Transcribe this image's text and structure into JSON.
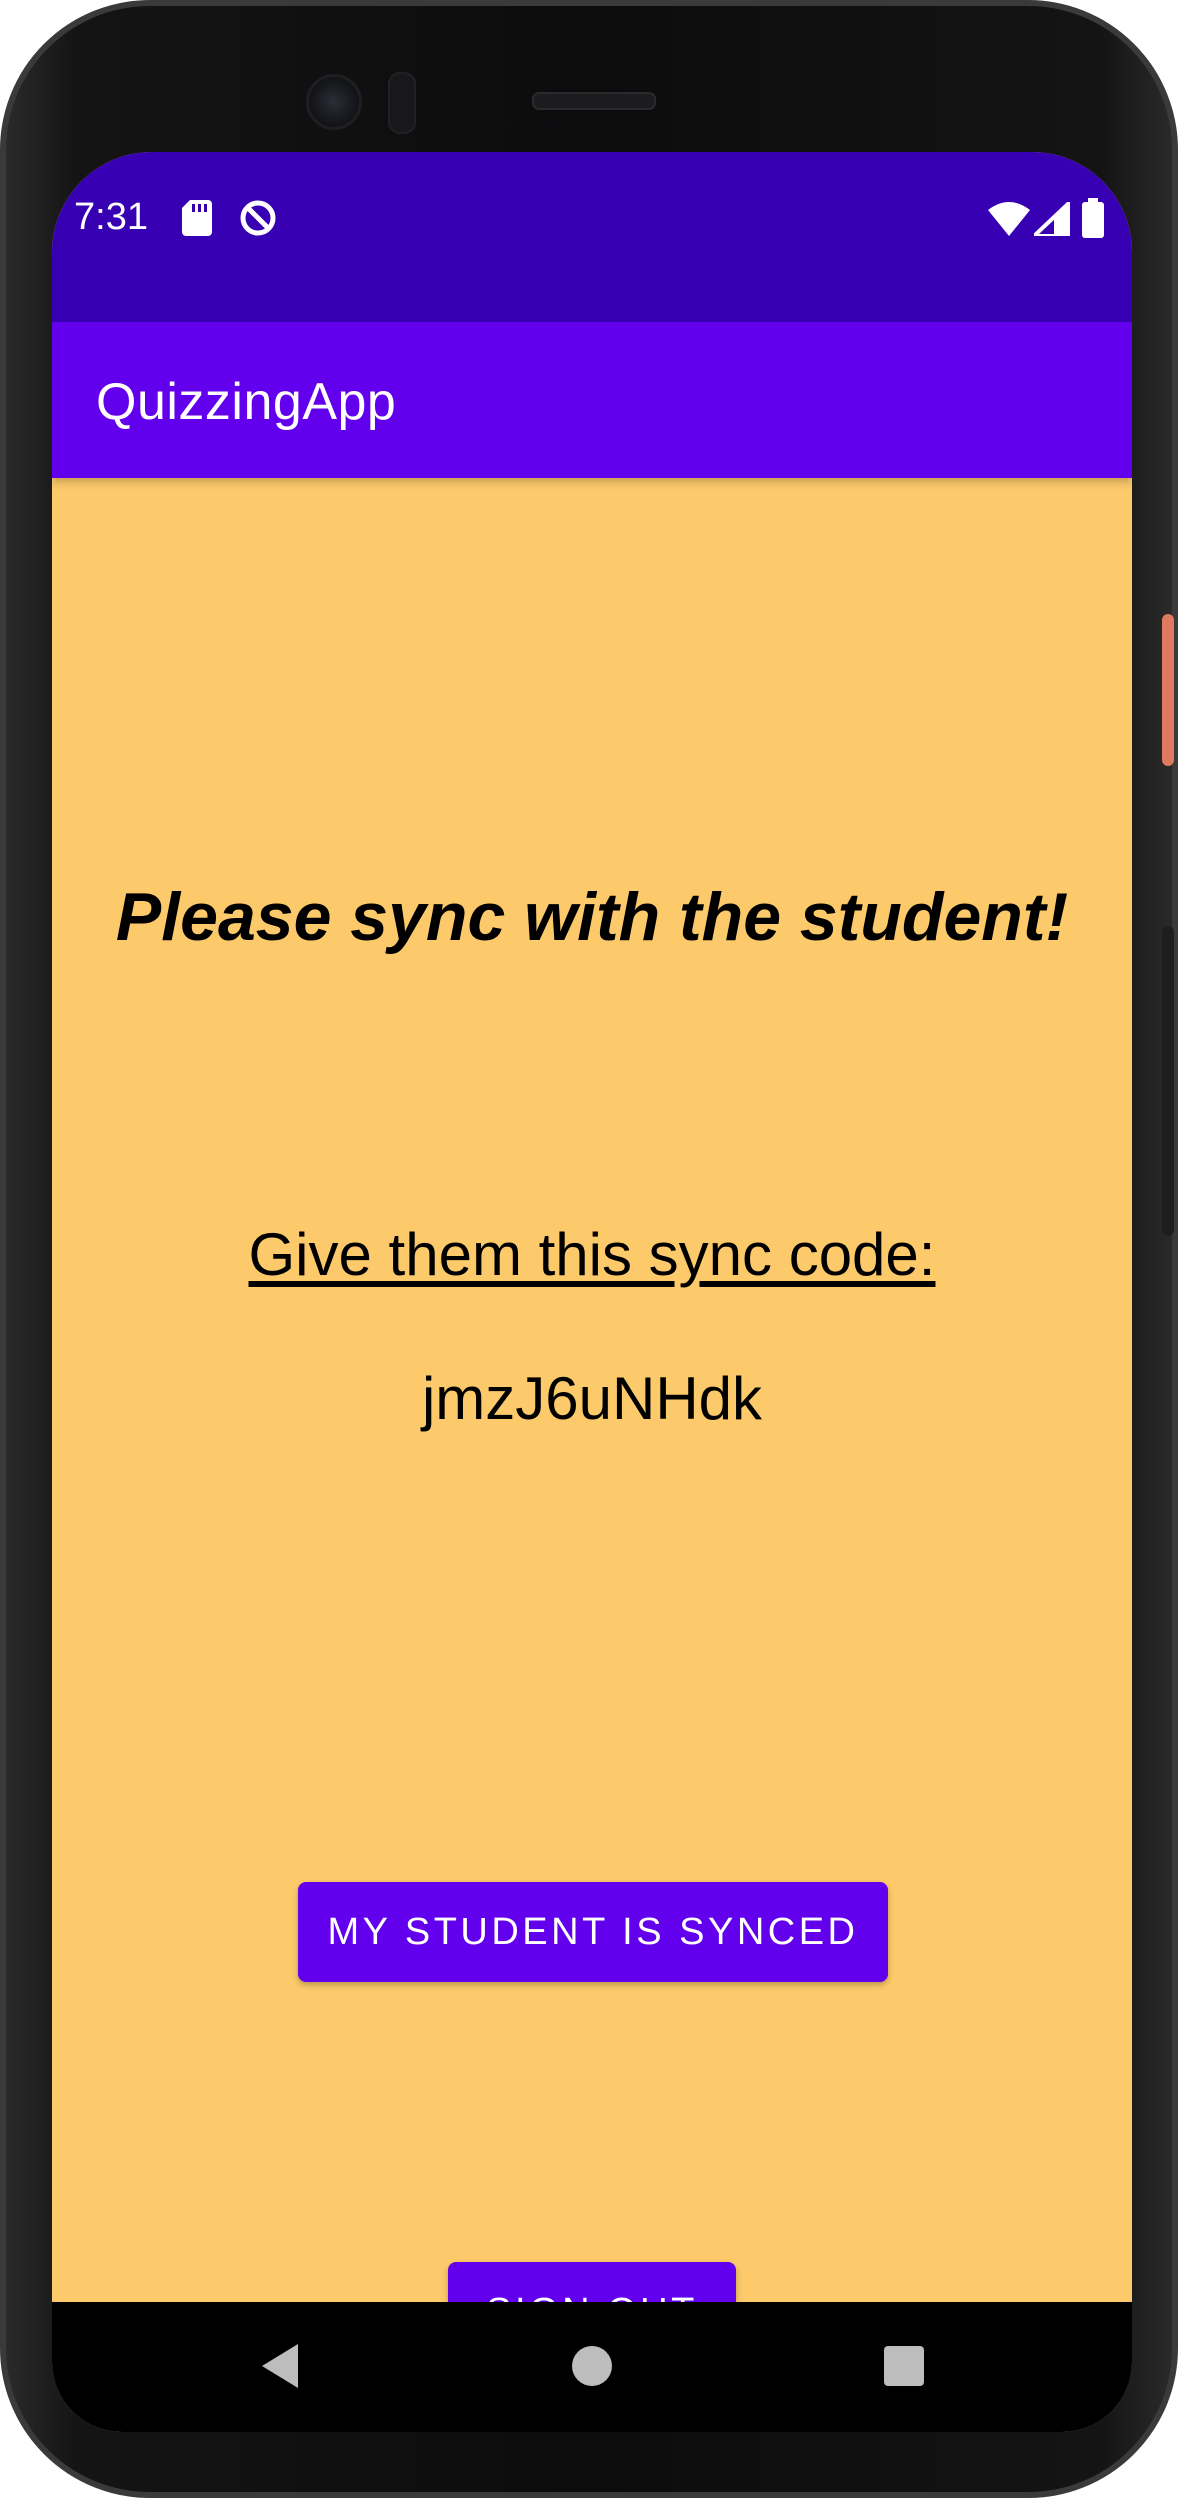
{
  "status_bar": {
    "time": "7:31",
    "icons": [
      "sd-card-icon",
      "data-saver-icon",
      "wifi-icon",
      "signal-icon",
      "battery-icon"
    ]
  },
  "app_bar": {
    "title": "QuizzingApp"
  },
  "main": {
    "heading": "Please sync with the student!",
    "code_label": "Give them this sync code:",
    "code_value": "jmzJ6uNHdk",
    "synced_button_label": "MY STUDENT IS SYNCED",
    "sign_out_button_label": "SIGN OUT"
  },
  "nav_bar": {
    "icons": [
      "back-icon",
      "home-icon",
      "recents-icon"
    ]
  },
  "colors": {
    "status_bar": "#3700b3",
    "app_bar": "#6200ee",
    "background": "#fcca6a",
    "button": "#6200ee"
  }
}
